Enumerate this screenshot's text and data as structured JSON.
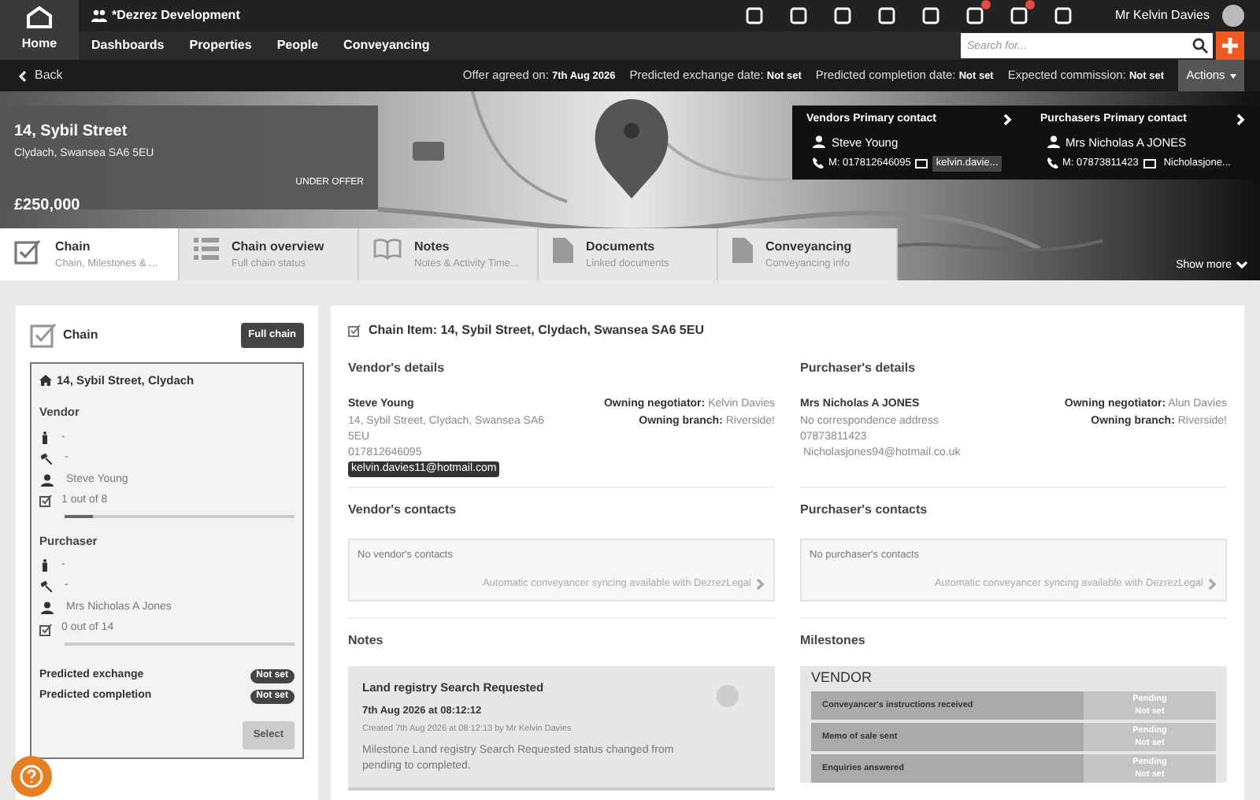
{
  "header": {
    "brand": "*Dezrez Development",
    "user": "Mr Kelvin Davies"
  },
  "nav": [
    {
      "label": "Home",
      "selected": true
    },
    {
      "label": "Dashboards",
      "selected": false
    },
    {
      "label": "Properties",
      "selected": false
    },
    {
      "label": "People",
      "selected": false
    },
    {
      "label": "Conveyancing",
      "selected": false
    }
  ],
  "search": {
    "placeholder": "Search for..."
  },
  "back_bar": {
    "back": "Back",
    "facts": [
      {
        "label": "Offer agreed on:",
        "value": "7th Aug 2026"
      },
      {
        "label": "Predicted exchange date:",
        "value": "Not set"
      },
      {
        "label": "Predicted completion date:",
        "value": "Not set"
      },
      {
        "label": "Expected commission:",
        "value": "Not set"
      }
    ],
    "actions": "Actions"
  },
  "property": {
    "title": "14, Sybil Street",
    "address": "Clydach, Swansea SA6 5EU",
    "status": "UNDER OFFER",
    "price": "£250,000"
  },
  "contacts": [
    {
      "title": "Vendors Primary contact",
      "name": "Steve Young",
      "phone": "M: 017812646095",
      "email": "kelvin.davie...",
      "email_highlighted": true
    },
    {
      "title": "Purchasers Primary contact",
      "name": "Mrs Nicholas A JONES",
      "phone": "M: 07873811423",
      "email": "Nicholasjone...",
      "email_highlighted": false
    }
  ],
  "tabs": [
    {
      "kind": "check",
      "title": "Chain",
      "subtitle": "Chain, Milestones & ...",
      "selected": true
    },
    {
      "kind": "list",
      "title": "Chain overview",
      "subtitle": "Full chain status",
      "selected": false
    },
    {
      "kind": "book",
      "title": "Notes",
      "subtitle": "Notes & Activity Time...",
      "selected": false
    },
    {
      "kind": "doc",
      "title": "Documents",
      "subtitle": "Linked documents",
      "selected": false
    },
    {
      "kind": "doc",
      "title": "Conveyancing",
      "subtitle": "Conveyancing info",
      "selected": false
    }
  ],
  "show_more": "Show more",
  "chain": {
    "title": "Chain",
    "full_chain": "Full chain",
    "address": "14, Sybil Street, Clydach",
    "parties": [
      {
        "title": "Vendor",
        "rows": [
          "-",
          "-",
          "Steve Young"
        ],
        "progress": "1 out of 8",
        "level": 0.125
      },
      {
        "title": "Purchaser",
        "rows": [
          "-",
          "-",
          "Mrs Nicholas A Jones"
        ],
        "progress": "0 out of 14",
        "level": 0
      }
    ],
    "dates": [
      {
        "label": "Predicted exchange",
        "value": "Not set"
      },
      {
        "label": "Predicted completion",
        "value": "Not set"
      }
    ],
    "select": "Select"
  },
  "chain_item": {
    "title": "Chain Item: 14, Sybil Street, Clydach, Swansea SA6 5EU",
    "details": [
      {
        "heading": "Vendor's details",
        "name": "Steve Young",
        "lines": [
          "14, Sybil Street, Clydach, Swansea SA6 5EU",
          "017812646095"
        ],
        "email": "kelvin.davies11@hotmail.com",
        "email_highlighted": true,
        "negotiator_label": "Owning negotiator:",
        "negotiator": "Kelvin Davies",
        "branch_label": "Owning branch:",
        "branch": "Riverside!"
      },
      {
        "heading": "Purchaser's details",
        "name": "Mrs Nicholas A JONES",
        "lines": [
          "No correspondence address",
          "07873811423"
        ],
        "email": "Nicholasjones94@hotmail.co.uk",
        "email_highlighted": false,
        "negotiator_label": "Owning negotiator:",
        "negotiator": "Alun Davies",
        "branch_label": "Owning branch:",
        "branch": "Riverside!"
      }
    ],
    "contacts": [
      {
        "heading": "Vendor's contacts",
        "empty": "No vendor's contacts",
        "sync": "Automatic conveyancer syncing available with DezrezLegal"
      },
      {
        "heading": "Purchaser's contacts",
        "empty": "No purchaser's contacts",
        "sync": "Automatic conveyancer syncing available with DezrezLegal"
      }
    ],
    "notes": {
      "heading": "Notes",
      "items": [
        {
          "title": "Land registry Search Requested",
          "date": "7th Aug 2026 at 08:12:12",
          "created": "Created 7th Aug 2026 at 08:12:13 by Mr Kelvin Davies",
          "body": "Milestone Land registry Search Requested status changed from pending to completed."
        }
      ]
    },
    "milestones": {
      "heading": "Milestones",
      "group": "VENDOR",
      "rows": [
        {
          "label": "Conveyancer's instructions received",
          "status": "Pending",
          "date": "Not set"
        },
        {
          "label": "Memo of sale sent",
          "status": "Pending",
          "date": "Not set"
        },
        {
          "label": "Enquiries answered",
          "status": "Pending",
          "date": "Not set"
        }
      ]
    }
  }
}
